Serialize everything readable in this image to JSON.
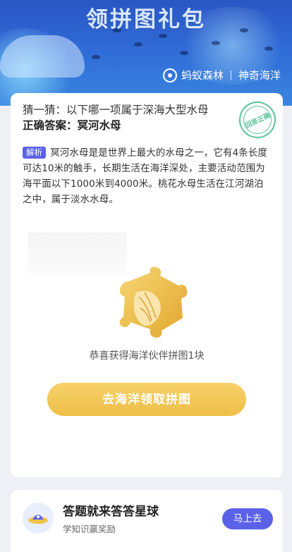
{
  "banner": {
    "title": "领拼图礼包",
    "brand_left": "蚂蚁森林",
    "brand_right": "神奇海洋"
  },
  "quiz": {
    "question": "猜一猜：以下哪一项属于深海大型水母",
    "answer": "正确答案：冥河水母",
    "stamp_text": "回答正确",
    "explain_tag": "解析",
    "explanation": "冥河水母是是世界上最大的水母之一，它有4条长度可达10米的触手，长期生活在海洋深处，主要活动范围为海平面以下1000米到4000米。桃花水母生活在江河湖泊之中，属于淡水水母。"
  },
  "reward": {
    "text": "恭喜获得海洋伙伴拼图1块",
    "cta_label": "去海洋领取拼图"
  },
  "footer": {
    "title": "答题就来答答星球",
    "subtitle": "学知识赢奖励",
    "button_label": "马上去"
  },
  "colors": {
    "accent": "#5b62e8",
    "cta": "#f1c453",
    "stamp": "#5cc39a"
  }
}
